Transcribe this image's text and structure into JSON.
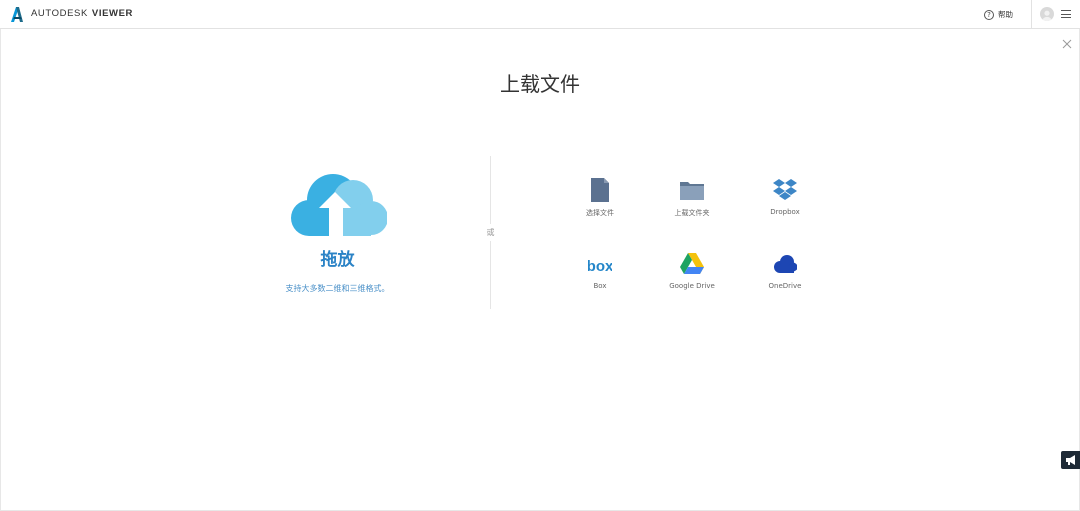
{
  "header": {
    "brand_name": "AUTODESK",
    "brand_product": "VIEWER",
    "help_icon_glyph": "?",
    "help_label": "帮助",
    "logo_icon": "autodesk-a-logo",
    "avatar_icon": "user-avatar",
    "menu_icon": "hamburger-menu"
  },
  "dialog": {
    "title": "上载文件",
    "close_icon": "close-x",
    "drop_zone": {
      "label": "拖放",
      "hint": "支持大多数二维和三维格式。",
      "icon": "cloud-upload"
    },
    "or_label": "或",
    "sources": [
      {
        "label": "选择文件",
        "icon": "file-icon"
      },
      {
        "label": "上载文件夹",
        "icon": "folder-icon"
      },
      {
        "label": "Dropbox",
        "icon": "dropbox-icon"
      },
      {
        "label": "Box",
        "icon": "box-icon"
      },
      {
        "label": "Google Drive",
        "icon": "google-drive-icon"
      },
      {
        "label": "OneDrive",
        "icon": "onedrive-icon"
      }
    ]
  },
  "colors": {
    "accent_blue": "#2b83c6",
    "cloud_dark": "#3ab0e2",
    "cloud_light": "#7fcdec",
    "file_gray": "#5b7190",
    "folder_gray": "#7b92ad",
    "dropbox_blue": "#3d86c6",
    "box_blue": "#2486c9",
    "onedrive_blue": "#1d46b3"
  }
}
